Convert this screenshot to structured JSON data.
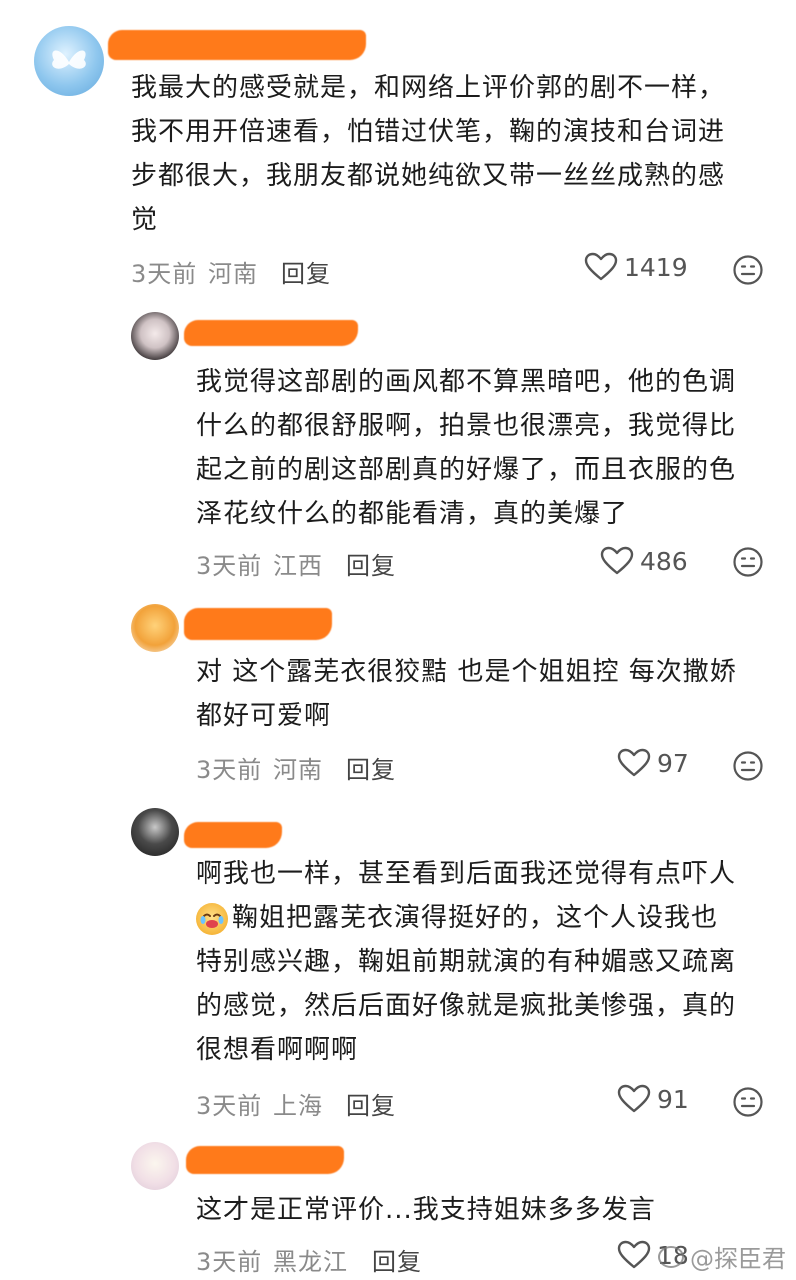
{
  "comments": [
    {
      "lines": [
        "我最大的感受就是，和网络上评价郭的剧不一样，",
        "我不用开倍速看，怕错过伏笔，鞠的演技和台词进",
        "步都很大，我朋友都说她纯欲又带一丝丝成熟的感",
        "觉"
      ],
      "time": "3天前",
      "location": "河南",
      "reply": "回复",
      "likes": "1419"
    },
    {
      "lines": [
        "我觉得这部剧的画风都不算黑暗吧，他的色调",
        "什么的都很舒服啊，拍景也很漂亮，我觉得比",
        "起之前的剧这部剧真的好爆了，而且衣服的色",
        "泽花纹什么的都能看清，真的美爆了"
      ],
      "time": "3天前",
      "location": "江西",
      "reply": "回复",
      "likes": "486"
    },
    {
      "lines": [
        "对 这个露芜衣很狡黠 也是个姐姐控 每次撒娇",
        "都好可爱啊"
      ],
      "time": "3天前",
      "location": "河南",
      "reply": "回复",
      "likes": "97"
    },
    {
      "lines": [
        "啊我也一样，甚至看到后面我还觉得有点吓人",
        "鞠姐把露芜衣演得挺好的，这个人设我也",
        "特别感兴趣，鞠姐前期就演的有种媚惑又疏离",
        "的感觉，然后后面好像就是疯批美惨强，真的",
        "很想看啊啊啊"
      ],
      "time": "3天前",
      "location": "上海",
      "reply": "回复",
      "likes": "91"
    },
    {
      "lines": [
        "这才是正常评价...我支持姐妹多多发言"
      ],
      "time": "3天前",
      "location": "黑龙江",
      "reply": "回复",
      "likes": "18"
    }
  ],
  "watermark": "@探臣君"
}
